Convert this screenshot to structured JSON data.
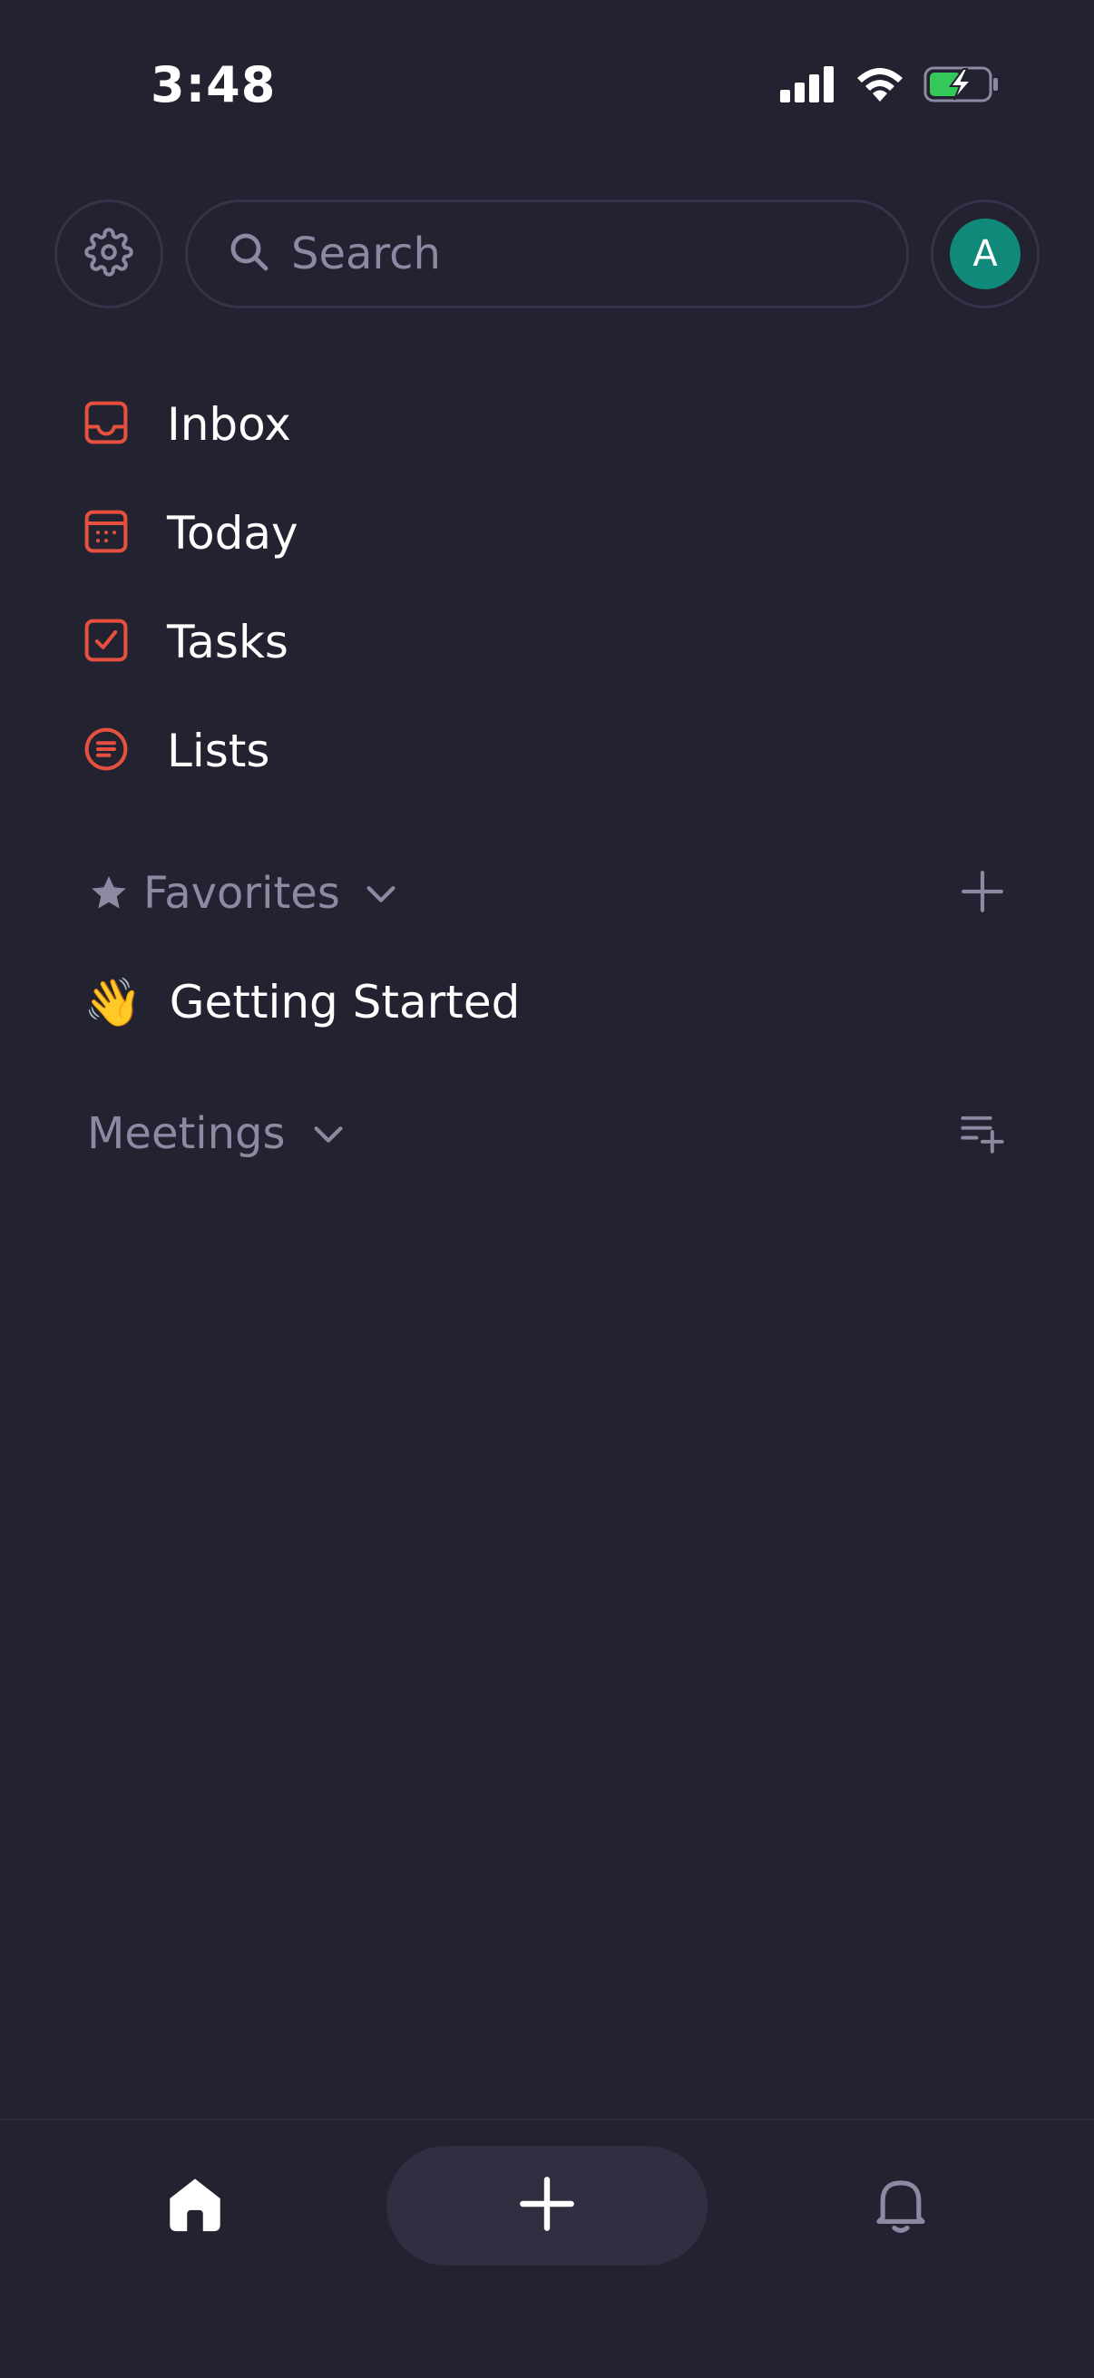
{
  "status": {
    "time": "3:48"
  },
  "search": {
    "placeholder": "Search"
  },
  "avatar": {
    "initial": "A"
  },
  "nav": {
    "items": [
      {
        "label": "Inbox",
        "icon": "inbox-icon"
      },
      {
        "label": "Today",
        "icon": "calendar-icon"
      },
      {
        "label": "Tasks",
        "icon": "task-check-icon"
      },
      {
        "label": "Lists",
        "icon": "list-icon"
      }
    ]
  },
  "favorites": {
    "title": "Favorites",
    "items": [
      {
        "emoji": "👋",
        "label": "Getting Started"
      }
    ]
  },
  "meetings": {
    "title": "Meetings"
  },
  "colors": {
    "background": "#232231",
    "accent": "#e5503f",
    "muted": "#8b8aa2",
    "avatar": "#0f8a7a",
    "battery": "#34c759"
  }
}
